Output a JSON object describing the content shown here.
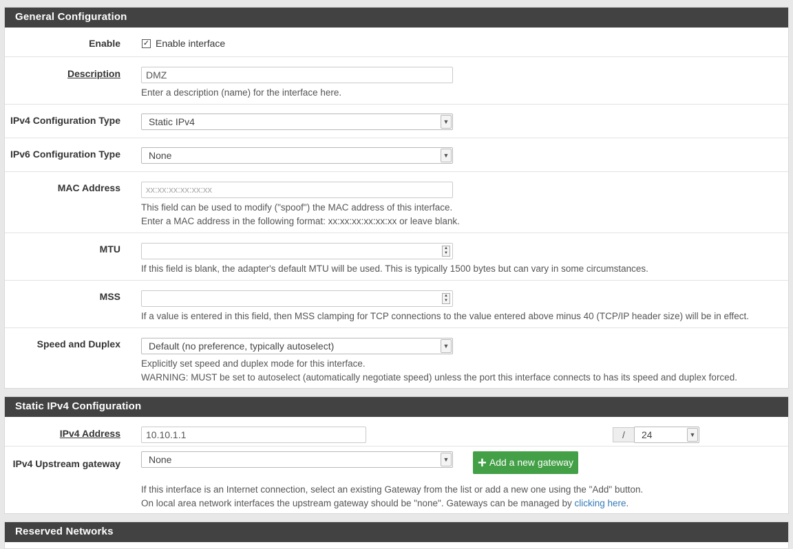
{
  "general": {
    "title": "General Configuration",
    "enable": {
      "label": "Enable",
      "checkbox_label": "Enable interface",
      "checked_glyph": "✓"
    },
    "description": {
      "label": "Description",
      "value": "DMZ",
      "help": "Enter a description (name) for the interface here."
    },
    "ipv4_type": {
      "label": "IPv4 Configuration Type",
      "selected": "Static IPv4"
    },
    "ipv6_type": {
      "label": "IPv6 Configuration Type",
      "selected": "None"
    },
    "mac": {
      "label": "MAC Address",
      "placeholder": "xx:xx:xx:xx:xx:xx",
      "help1": "This field can be used to modify (\"spoof\") the MAC address of this interface.",
      "help2": "Enter a MAC address in the following format: xx:xx:xx:xx:xx:xx or leave blank."
    },
    "mtu": {
      "label": "MTU",
      "value": "",
      "help": "If this field is blank, the adapter's default MTU will be used. This is typically 1500 bytes but can vary in some circumstances."
    },
    "mss": {
      "label": "MSS",
      "value": "",
      "help": "If a value is entered in this field, then MSS clamping for TCP connections to the value entered above minus 40 (TCP/IP header size) will be in effect."
    },
    "speed": {
      "label": "Speed and Duplex",
      "selected": "Default (no preference, typically autoselect)",
      "help1": "Explicitly set speed and duplex mode for this interface.",
      "help2": "WARNING: MUST be set to autoselect (automatically negotiate speed) unless the port this interface connects to has its speed and duplex forced."
    }
  },
  "static_ipv4": {
    "title": "Static IPv4 Configuration",
    "address": {
      "label": "IPv4 Address",
      "value": "10.10.1.1",
      "slash": "/",
      "cidr": "24"
    },
    "gateway": {
      "label": "IPv4 Upstream gateway",
      "selected": "None",
      "add_button": "Add a new gateway",
      "help1": "If this interface is an Internet connection, select an existing Gateway from the list or add a new one using the \"Add\" button.",
      "help2_prefix": "On local area network interfaces the upstream gateway should be \"none\". Gateways can be managed by ",
      "help2_link": "clicking here",
      "help2_suffix": "."
    }
  },
  "reserved": {
    "title": "Reserved Networks"
  },
  "icons": {
    "caret": "▼",
    "spin_up": "▲",
    "spin_down": "▼",
    "plus": "+"
  },
  "colors": {
    "heading_bg": "#424242",
    "success": "#43a047",
    "link": "#337ab7"
  }
}
